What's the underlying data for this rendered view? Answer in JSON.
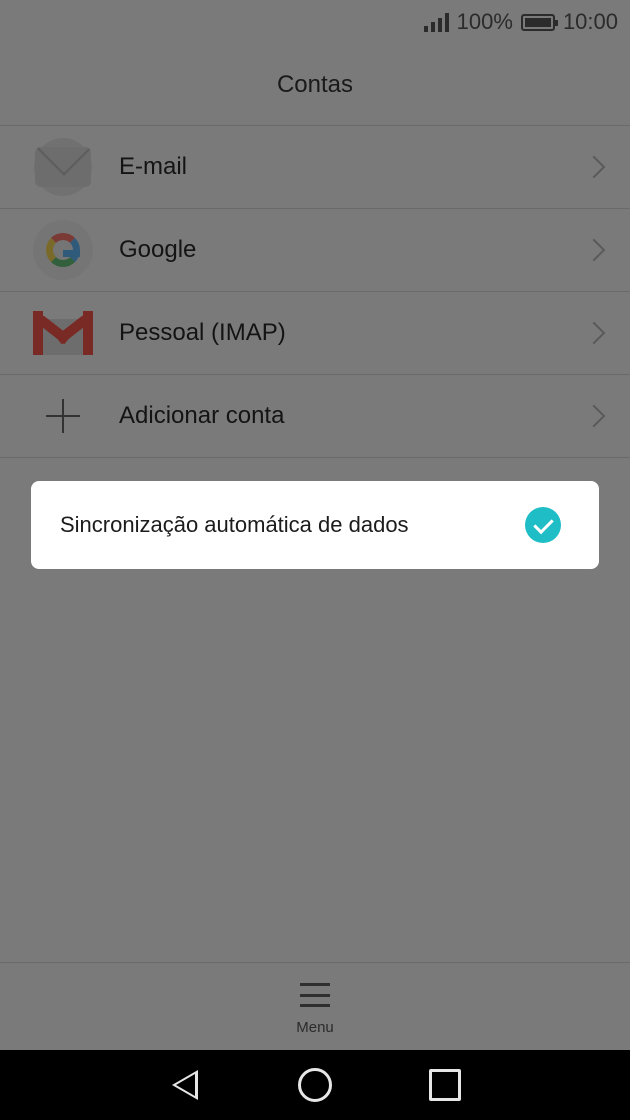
{
  "status_bar": {
    "battery_percent": "100%",
    "time": "10:00"
  },
  "header": {
    "title": "Contas"
  },
  "accounts": [
    {
      "label": "E-mail",
      "icon": "email-icon"
    },
    {
      "label": "Google",
      "icon": "google-icon"
    },
    {
      "label": "Pessoal (IMAP)",
      "icon": "gmail-icon"
    },
    {
      "label": "Adicionar conta",
      "icon": "plus-icon"
    }
  ],
  "popup": {
    "label": "Sincronização automática de dados",
    "checked": true,
    "accent": "#1fbdc6"
  },
  "bottom_menu": {
    "label": "Menu"
  },
  "nav": {
    "back": "back-icon",
    "home": "home-icon",
    "recents": "recents-icon"
  }
}
